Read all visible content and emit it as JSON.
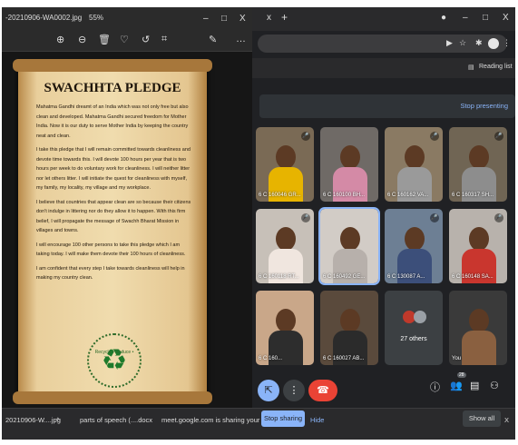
{
  "viewer": {
    "file_name": "-20210906-WA0002.jpg",
    "zoom": "55%",
    "window_controls": [
      "–",
      "□",
      "X"
    ],
    "toolbar_icons": [
      "zoom-in-icon",
      "zoom-out-icon",
      "delete-icon",
      "favorite-icon",
      "rotate-icon",
      "crop-icon",
      "edit-icon",
      "more-icon"
    ],
    "pledge": {
      "title": "SWACHHTA PLEDGE",
      "paragraphs": [
        "Mahatma Gandhi dreamt of an India which was not only free but also clean and developed. Mahatma Gandhi secured freedom for Mother India. Now it is our duty to serve Mother India by keeping the country neat and clean.",
        "I take this pledge that I will remain committed towards cleanliness and devote time towards this. I will devote 100 hours per year that is two hours per week to do voluntary work for cleanliness. I will neither litter nor let others litter. I will initiate the quest for cleanliness with myself, my family, my locality, my village and my workplace.",
        "I believe that countries that appear clean are so because their citizens don't indulge in littering nor do they allow it to happen. With this firm belief, I will propagate the message of Swachh Bharat Mission in villages and towns.",
        "I will encourage 100 other persons to take this pledge which I am taking today. I will make them devote their 100 hours of cleanliness.",
        "I am confident that every step I take towards cleanliness will help in making my country clean."
      ],
      "recycle_text": "Recycle • Reduce • Reuse"
    }
  },
  "browser": {
    "tab_close": "x",
    "new_tab": "+",
    "reading_list": "Reading list",
    "window_controls": [
      "–",
      "□",
      "X"
    ]
  },
  "meet": {
    "stop_presenting": "Stop presenting",
    "tiles": [
      {
        "label": "6 C 160046 GR...",
        "bg": "#7a6a55",
        "shirt": "#e7b400",
        "mic": "ᶻ"
      },
      {
        "label": "6 C 160100 BH...",
        "bg": "#6f6a66",
        "shirt": "#d48aa6",
        "mic": ""
      },
      {
        "label": "6 C 160162 VA...",
        "bg": "#8a7a63",
        "shirt": "#9a9a9a",
        "mic": "ᶻ"
      },
      {
        "label": "6 C 160317 SH...",
        "bg": "#706554",
        "shirt": "#8d8d8d",
        "mic": "ᶻ"
      },
      {
        "label": "6 C 160118 RT...",
        "bg": "#c7c0b8",
        "shirt": "#f0e6df",
        "mic": "ᶻ"
      },
      {
        "label": "6 C 160492 GE...",
        "bg": "#d2ccc6",
        "shirt": "#b7b0ab",
        "mic": ""
      },
      {
        "label": "6 C 130087 A...",
        "bg": "#6d7f94",
        "shirt": "#3c4f7a",
        "mic": "ᶻ"
      },
      {
        "label": "6 C 160148 SA...",
        "bg": "#b8b2ac",
        "shirt": "#c9362e",
        "mic": "ᶻ"
      },
      {
        "label": "6 C 160...",
        "bg": "#c9a789",
        "shirt": "#2d2d2d",
        "mic": ""
      },
      {
        "label": "6 C 160027 AB...",
        "bg": "#5a4a3c",
        "shirt": "#2b2b2b",
        "mic": ""
      },
      {
        "label": "You",
        "bg": "#3a3a3a",
        "shirt": "#8a6040",
        "mic": ""
      }
    ],
    "others_label": "27 others",
    "participant_count": "28",
    "controls": {
      "present_icon": "present-icon",
      "more_icon": "more-vert-icon",
      "hangup_icon": "hang-up-icon"
    }
  },
  "taskbar": {
    "item1": "20210906-W....jpg",
    "item1_caret": "^",
    "item2": "parts of speech (....docx",
    "share_msg": "meet.google.com is sharing your screen.",
    "stop_sharing": "Stop sharing",
    "hide": "Hide",
    "show_all": "Show all",
    "close": "X"
  },
  "colors": {
    "meet_bg": "#202124",
    "accent_blue": "#8ab4f8",
    "hangup_red": "#ea4335",
    "parchment": "#f0dcae",
    "recycle_green": "#1e7a2b"
  }
}
